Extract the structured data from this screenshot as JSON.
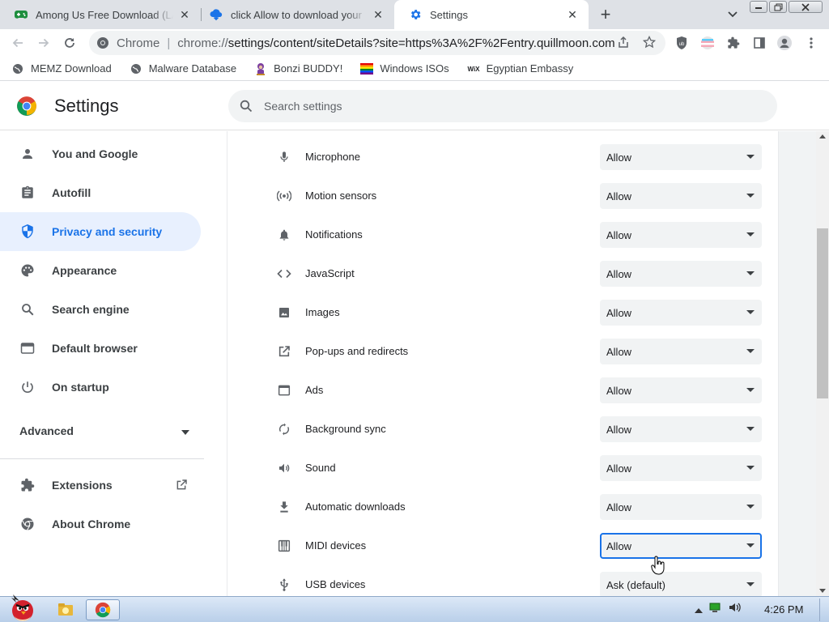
{
  "tabs": [
    {
      "title": "Among Us Free Download (LA",
      "favicon": "gamepad-icon",
      "active": false
    },
    {
      "title": "click Allow to download your",
      "favicon": "cloud-download-icon",
      "active": false
    },
    {
      "title": "Settings",
      "favicon": "gear-icon",
      "active": true
    }
  ],
  "toolbar": {
    "site_chip": "Chrome",
    "url_prefix": "chrome://",
    "url_rest": "settings/content/siteDetails?site=https%3A%2F%2Fentry.quillmoon.com"
  },
  "bookmarks": [
    {
      "label": "MEMZ Download",
      "icon": "globe-icon"
    },
    {
      "label": "Malware Database",
      "icon": "globe-icon"
    },
    {
      "label": "Bonzi BUDDY!",
      "icon": "bonzi-icon"
    },
    {
      "label": "Windows ISOs",
      "icon": "rainbow-flag-icon"
    },
    {
      "label": "Egyptian Embassy",
      "icon": "wix-icon"
    }
  ],
  "header": {
    "title": "Settings",
    "search_placeholder": "Search settings"
  },
  "sidebar": {
    "items": [
      {
        "label": "You and Google",
        "icon": "person-icon"
      },
      {
        "label": "Autofill",
        "icon": "clipboard-icon"
      },
      {
        "label": "Privacy and security",
        "icon": "shield-icon",
        "active": true
      },
      {
        "label": "Appearance",
        "icon": "palette-icon"
      },
      {
        "label": "Search engine",
        "icon": "search-icon"
      },
      {
        "label": "Default browser",
        "icon": "browser-icon"
      },
      {
        "label": "On startup",
        "icon": "power-icon"
      }
    ],
    "advanced": "Advanced",
    "extensions": "Extensions",
    "about": "About Chrome"
  },
  "permissions": [
    {
      "label": "Microphone",
      "icon": "microphone-icon",
      "value": "Allow"
    },
    {
      "label": "Motion sensors",
      "icon": "motion-sensors-icon",
      "value": "Allow"
    },
    {
      "label": "Notifications",
      "icon": "bell-icon",
      "value": "Allow"
    },
    {
      "label": "JavaScript",
      "icon": "code-icon",
      "value": "Allow"
    },
    {
      "label": "Images",
      "icon": "image-icon",
      "value": "Allow"
    },
    {
      "label": "Pop-ups and redirects",
      "icon": "open-in-new-icon",
      "value": "Allow"
    },
    {
      "label": "Ads",
      "icon": "ads-window-icon",
      "value": "Allow"
    },
    {
      "label": "Background sync",
      "icon": "sync-icon",
      "value": "Allow"
    },
    {
      "label": "Sound",
      "icon": "speaker-icon",
      "value": "Allow"
    },
    {
      "label": "Automatic downloads",
      "icon": "download-icon",
      "value": "Allow"
    },
    {
      "label": "MIDI devices",
      "icon": "piano-icon",
      "value": "Allow",
      "focused": true
    },
    {
      "label": "USB devices",
      "icon": "usb-icon",
      "value": "Ask (default)"
    }
  ],
  "taskbar": {
    "clock": "4:26 PM"
  },
  "colors": {
    "accent": "#1a73e8",
    "active_nav_bg": "#e8f0fe"
  }
}
